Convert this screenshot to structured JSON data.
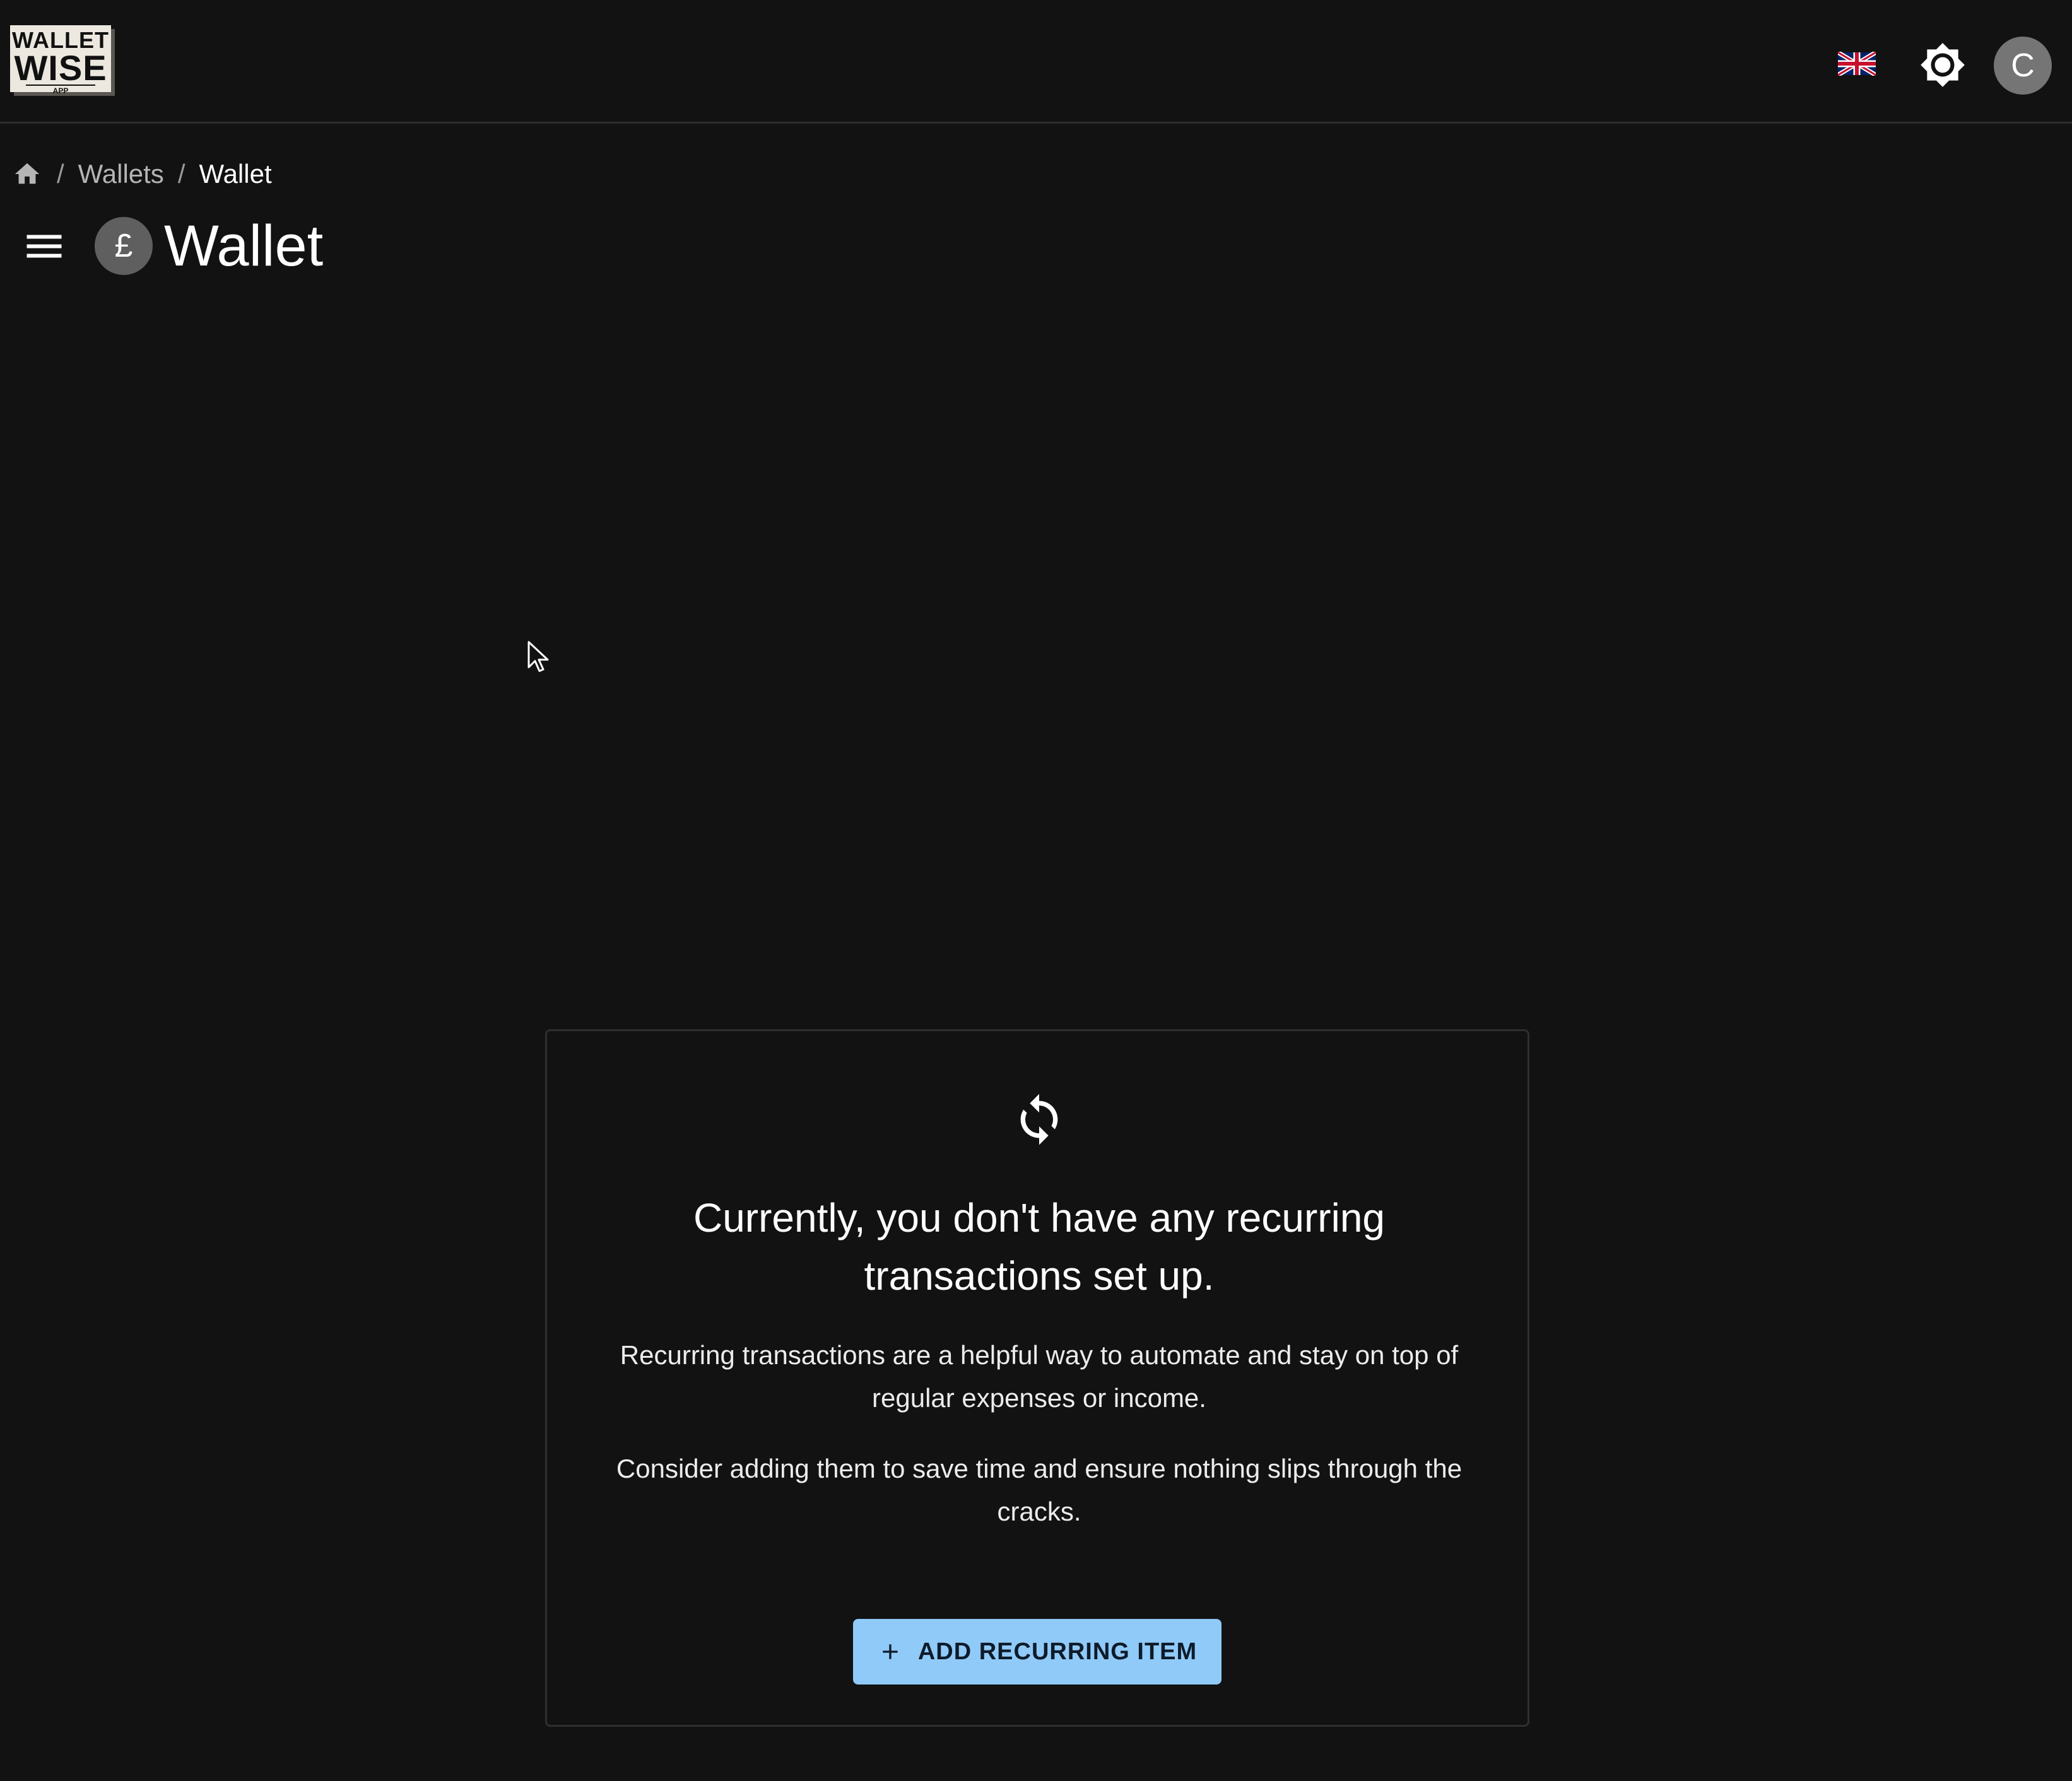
{
  "header": {
    "logo": {
      "line1": "WALLET",
      "line2": "WISE",
      "line3": "APP"
    },
    "language_icon": "uk-flag-icon",
    "theme_icon": "brightness-icon",
    "avatar_initial": "C"
  },
  "breadcrumb": {
    "home_icon": "home-icon",
    "items": [
      "Wallets",
      "Wallet"
    ],
    "separator": "/"
  },
  "page": {
    "menu_icon": "hamburger-menu-icon",
    "currency_symbol": "£",
    "title": "Wallet"
  },
  "empty_state": {
    "icon": "sync-icon",
    "title": "Currently, you don't have any recurring transactions set up.",
    "description": "Recurring transactions are a helpful way to automate and stay on top of regular expenses or income.",
    "suggestion": "Consider adding them to save time and ensure nothing slips through the cracks.",
    "button_label": "ADD RECURRING ITEM",
    "button_icon": "plus-icon"
  },
  "colors": {
    "background": "#121212",
    "accent": "#90caf9",
    "avatar": "#757575"
  }
}
